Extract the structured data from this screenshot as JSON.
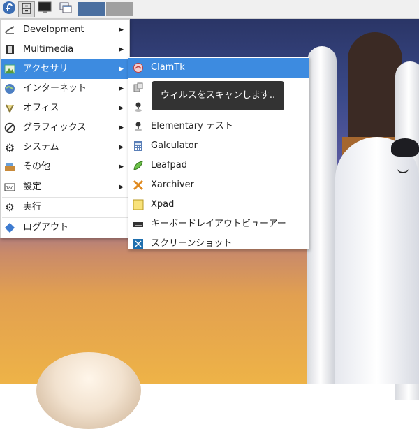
{
  "panel": {
    "menu_button": "fedora-icon",
    "file_manager_icon": "drawer-icon",
    "terminal_icon": "terminal-icon",
    "windows_icon": "windows-icon",
    "workspace_colors": [
      "#4a6fa0",
      "#a0a0a0"
    ]
  },
  "main_menu": {
    "items": [
      {
        "label": "Development",
        "icon": "wrench-icon",
        "submenu": true
      },
      {
        "label": "Multimedia",
        "icon": "film-icon",
        "submenu": true
      },
      {
        "label": "アクセサリ",
        "icon": "picture-icon",
        "submenu": true,
        "selected": true
      },
      {
        "label": "インターネット",
        "icon": "globe-icon",
        "submenu": true
      },
      {
        "label": "オフィス",
        "icon": "office-icon",
        "submenu": true
      },
      {
        "label": "グラフィックス",
        "icon": "palette-icon",
        "submenu": true
      },
      {
        "label": "システム",
        "icon": "gear-icon",
        "submenu": true
      },
      {
        "label": "その他",
        "icon": "box-icon",
        "submenu": true
      },
      {
        "label": "設定",
        "icon": "settings-icon",
        "submenu": true
      },
      {
        "label": "実行",
        "icon": "run-gear-icon",
        "submenu": false
      },
      {
        "label": "ログアウト",
        "icon": "logout-icon",
        "submenu": false
      }
    ]
  },
  "accessories_menu": {
    "items": [
      {
        "label": "ClamTk",
        "icon": "clamtk-icon",
        "selected": true
      },
      {
        "label": "",
        "icon": "archive-icon"
      },
      {
        "label": "",
        "icon": "joystick-icon"
      },
      {
        "label": "Elementary テスト",
        "icon": "elementary-icon"
      },
      {
        "label": "Galculator",
        "icon": "calculator-icon"
      },
      {
        "label": "Leafpad",
        "icon": "leafpad-icon"
      },
      {
        "label": "Xarchiver",
        "icon": "xarchiver-icon"
      },
      {
        "label": "Xpad",
        "icon": "note-icon"
      },
      {
        "label": "キーボードレイアウトビューアー",
        "icon": "keyboard-icon"
      },
      {
        "label": "スクリーンショット",
        "icon": "screenshot-icon"
      }
    ]
  },
  "tooltip": {
    "text": "ウィルスをスキャンします.."
  }
}
